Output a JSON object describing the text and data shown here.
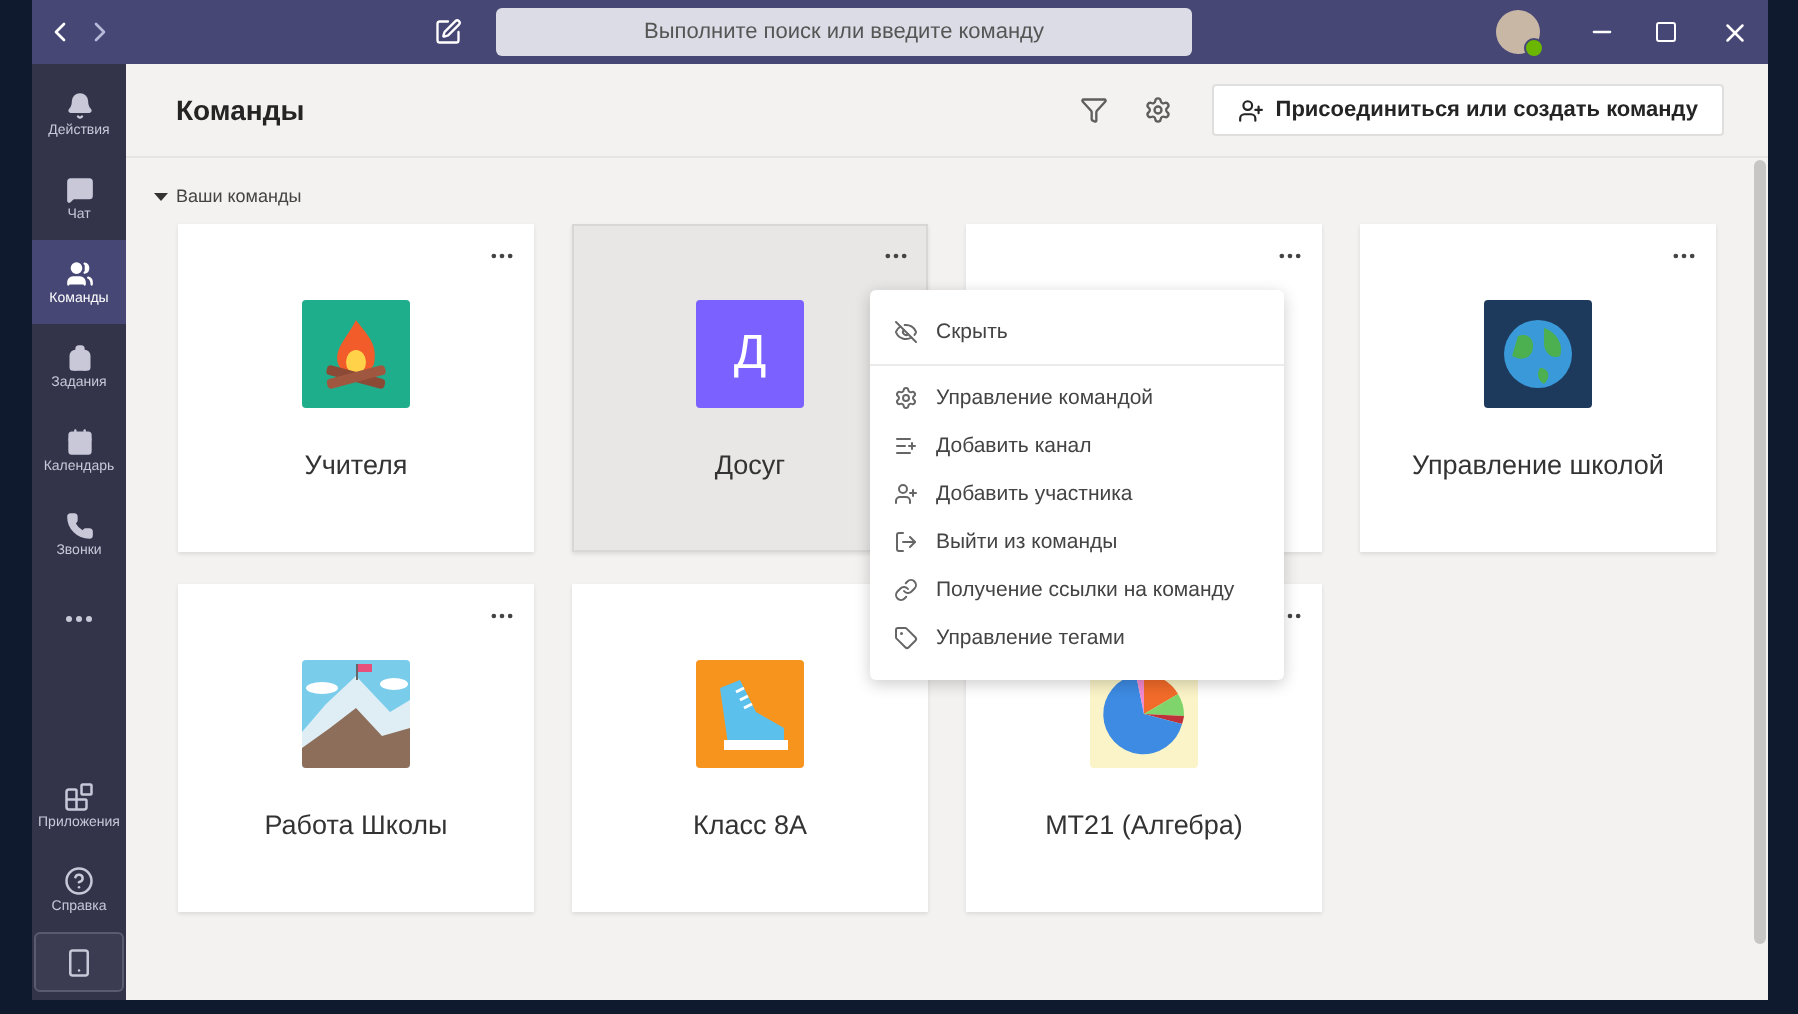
{
  "title_bar": {
    "search": {
      "placeholder": "Выполните поиск или введите команду"
    }
  },
  "sidebar": {
    "items": [
      {
        "label": "Действия",
        "selected": false
      },
      {
        "label": "Чат",
        "selected": false
      },
      {
        "label": "Команды",
        "selected": true
      },
      {
        "label": "Задания",
        "selected": false
      },
      {
        "label": "Календарь",
        "selected": false
      },
      {
        "label": "Звонки",
        "selected": false
      }
    ],
    "bottom_items": [
      {
        "label": "Приложения"
      },
      {
        "label": "Справка"
      }
    ]
  },
  "header": {
    "title": "Команды",
    "join_button": "Присоединиться или создать команду"
  },
  "section": {
    "label": "Ваши команды",
    "expanded": true
  },
  "teams": [
    {
      "name": "Учителя",
      "color": "#1fae8c",
      "highlighted": false,
      "more_button": true
    },
    {
      "name": "Досуг",
      "color": "#7b61ff",
      "avatar_text": "Д",
      "highlighted": true,
      "more_button": true
    },
    {
      "highlighted": false,
      "more_button": true
    },
    {
      "name": "Управление школой",
      "color": "#1d3a5c",
      "highlighted": false,
      "more_button": true
    },
    {
      "name": "Работа Школы",
      "color": "#79cdea",
      "highlighted": false,
      "more_button": true
    },
    {
      "name": "Класс 8А",
      "color": "#f7941d",
      "highlighted": false,
      "more_button": false
    },
    {
      "name": "МТ21 (Алгебра)",
      "color": "#fbf4c8",
      "highlighted": false,
      "more_button": true
    }
  ],
  "context_menu": {
    "sections": [
      [
        "Скрыть"
      ],
      [
        "Управление командой",
        "Добавить канал",
        "Добавить участника",
        "Выйти из команды",
        "Получение ссылки на команду",
        "Управление тегами"
      ]
    ]
  }
}
